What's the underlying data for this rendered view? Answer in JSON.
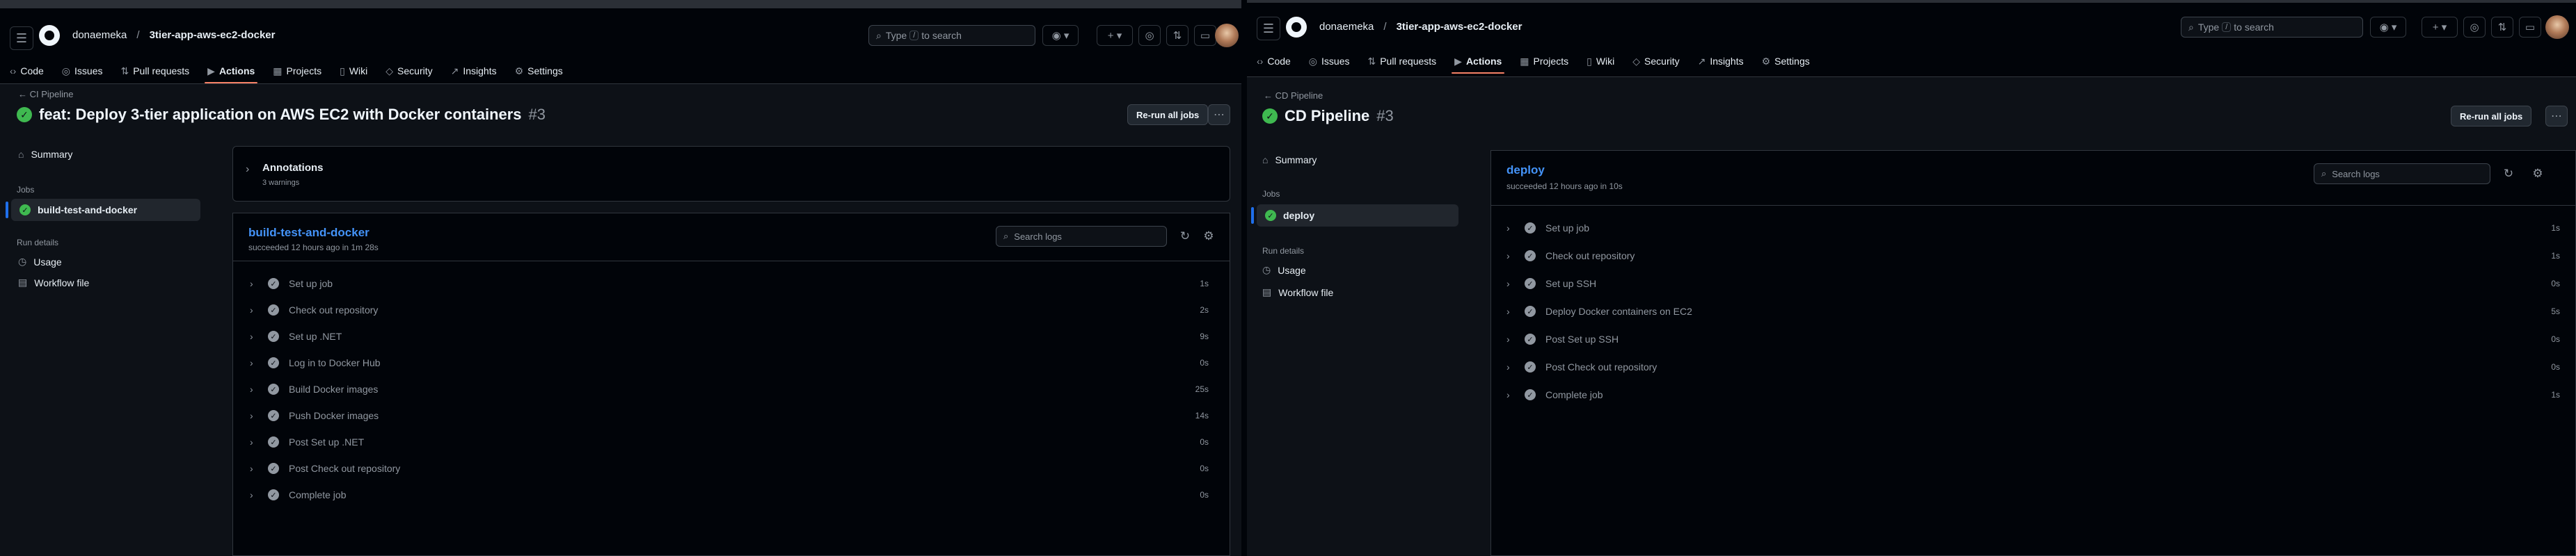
{
  "left": {
    "user": "donaemeka",
    "repo": "3tier-app-aws-ec2-docker",
    "search": {
      "prefix": "Type",
      "key": "/",
      "suffix": "to search"
    },
    "tabs": [
      {
        "label": "Code"
      },
      {
        "label": "Issues"
      },
      {
        "label": "Pull requests"
      },
      {
        "label": "Actions"
      },
      {
        "label": "Projects"
      },
      {
        "label": "Wiki"
      },
      {
        "label": "Security"
      },
      {
        "label": "Insights"
      },
      {
        "label": "Settings"
      }
    ],
    "back_label": "CI Pipeline",
    "run_title": "feat: Deploy 3-tier application on AWS EC2 with Docker containers",
    "run_number": "#3",
    "rerun_label": "Re-run all jobs",
    "sidebar": {
      "summary": "Summary",
      "jobs_heading": "Jobs",
      "job": "build-test-and-docker",
      "run_details": "Run details",
      "usage": "Usage",
      "workflow_file": "Workflow file"
    },
    "annotations": {
      "title": "Annotations",
      "subtitle": "3 warnings"
    },
    "job": {
      "name": "build-test-and-docker",
      "status": "succeeded 12 hours ago in 1m 28s",
      "search_placeholder": "Search logs",
      "steps": [
        {
          "name": "Set up job",
          "dur": "1s"
        },
        {
          "name": "Check out repository",
          "dur": "2s"
        },
        {
          "name": "Set up .NET",
          "dur": "9s"
        },
        {
          "name": "Log in to Docker Hub",
          "dur": "0s"
        },
        {
          "name": "Build Docker images",
          "dur": "25s"
        },
        {
          "name": "Push Docker images",
          "dur": "14s"
        },
        {
          "name": "Post Set up .NET",
          "dur": "0s"
        },
        {
          "name": "Post Check out repository",
          "dur": "0s"
        },
        {
          "name": "Complete job",
          "dur": "0s"
        }
      ]
    }
  },
  "right": {
    "user": "donaemeka",
    "repo": "3tier-app-aws-ec2-docker",
    "search": {
      "prefix": "Type",
      "key": "/",
      "suffix": "to search"
    },
    "tabs": [
      {
        "label": "Code"
      },
      {
        "label": "Issues"
      },
      {
        "label": "Pull requests"
      },
      {
        "label": "Actions"
      },
      {
        "label": "Projects"
      },
      {
        "label": "Wiki"
      },
      {
        "label": "Security"
      },
      {
        "label": "Insights"
      },
      {
        "label": "Settings"
      }
    ],
    "back_label": "CD Pipeline",
    "run_title": "CD Pipeline",
    "run_number": "#3",
    "rerun_label": "Re-run all jobs",
    "sidebar": {
      "summary": "Summary",
      "jobs_heading": "Jobs",
      "job": "deploy",
      "run_details": "Run details",
      "usage": "Usage",
      "workflow_file": "Workflow file"
    },
    "job": {
      "name": "deploy",
      "status": "succeeded 12 hours ago in 10s",
      "search_placeholder": "Search logs",
      "steps": [
        {
          "name": "Set up job",
          "dur": "1s"
        },
        {
          "name": "Check out repository",
          "dur": "1s"
        },
        {
          "name": "Set up SSH",
          "dur": "0s"
        },
        {
          "name": "Deploy Docker containers on EC2",
          "dur": "5s"
        },
        {
          "name": "Post Set up SSH",
          "dur": "0s"
        },
        {
          "name": "Post Check out repository",
          "dur": "0s"
        },
        {
          "name": "Complete job",
          "dur": "1s"
        }
      ]
    }
  }
}
